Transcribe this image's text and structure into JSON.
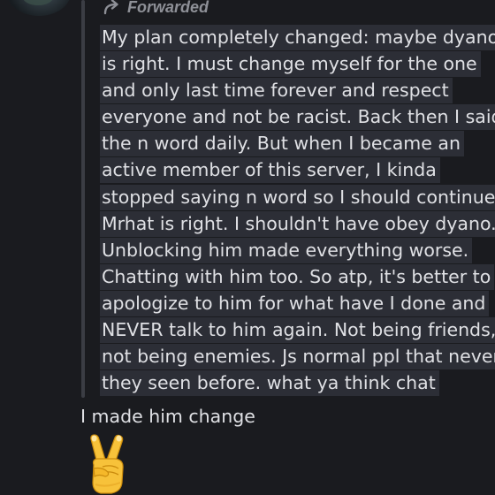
{
  "message": {
    "forward_label": "Forwarded",
    "forwarded_lines": [
      "My plan completely changed: maybe dyano",
      "is right. I must change myself for the one",
      "and only last time forever and respect",
      "everyone and not be racist. Back then I said",
      "the n word daily. But when I became an",
      "active member of this server, I kinda",
      "stopped saying n word so I should continue.",
      "Mrhat is right. I shouldn't have obey dyano.",
      "Unblocking him made everything worse.",
      "Chatting with him too. So atp, it's better to",
      "apologize to him for what have I done and",
      "NEVER talk to him again. Not being friends,",
      "not being enemies. Js normal ppl that never",
      "they seen before. what ya think chat"
    ],
    "reply_text": "I made him change",
    "emoji": "victory-hand-emoji"
  },
  "colors": {
    "background": "#1a1b1f",
    "text": "#dfe0e4",
    "highlight": "#2c2e36",
    "forward_bar": "#3b3d44",
    "muted": "#8e9097"
  }
}
